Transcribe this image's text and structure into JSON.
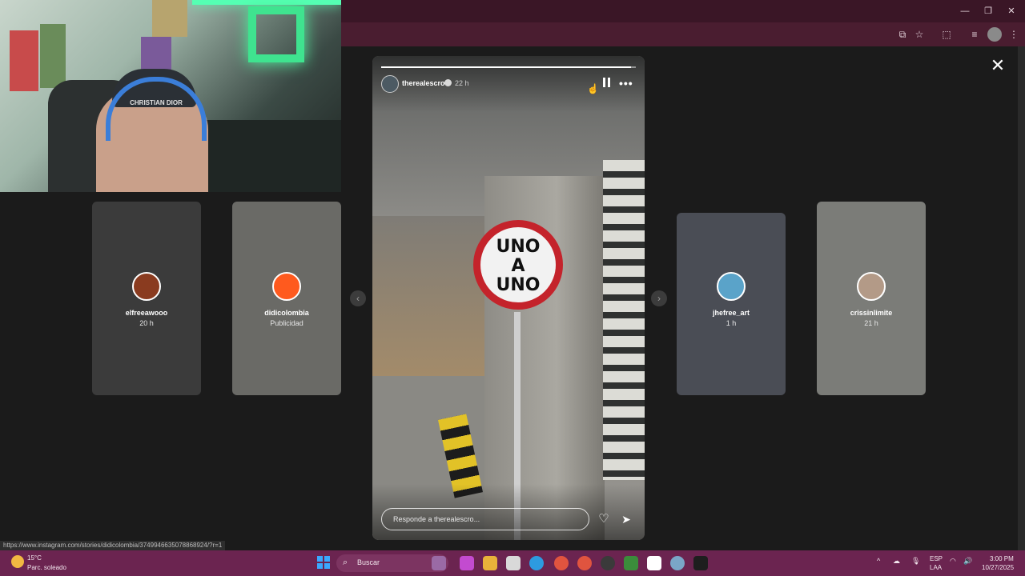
{
  "browser": {
    "window_controls": {
      "minimize": "—",
      "restore": "❐",
      "close": "✕"
    },
    "toolbar_icons": [
      "screencast-icon",
      "star-icon",
      "extensions-icon",
      "media-icon",
      "profile-icon",
      "menu-icon"
    ]
  },
  "webcam": {
    "cap_text": "CHRISTIAN DIOR"
  },
  "cards": [
    {
      "username": "elfreeawooo",
      "sub": "20 h",
      "bg": "#3b3b3b",
      "avatar": "#8a3b1f"
    },
    {
      "username": "didicolombia",
      "sub": "Publicidad",
      "bg": "#6a6a66",
      "avatar": "#ff5a1e"
    },
    {
      "username": "jhefree_art",
      "sub": "1 h",
      "bg": "#4a4d55",
      "avatar": "#5aa3c9"
    },
    {
      "username": "crissinlimite",
      "sub": "21 h",
      "bg": "#7b7c78",
      "avatar": "#b39a87"
    }
  ],
  "story": {
    "username": "therealescro",
    "time": "22 h",
    "progress": 0.98,
    "sign_lines": [
      "UNO",
      "A",
      "UNO"
    ],
    "reply_placeholder": "Responde a therealescro...",
    "more_label": "•••"
  },
  "nav": {
    "prev": "‹",
    "next": "›",
    "close": "✕"
  },
  "status_url": "https://www.instagram.com/stories/didicolombia/3749946635078868924/?r=1",
  "taskbar": {
    "weather_temp": "15°C",
    "weather_cond": "Parc. soleado",
    "search_label": "Buscar",
    "lang_line1": "ESP",
    "lang_line2": "LAA",
    "time": "3:00 PM",
    "date": "10/27/2025"
  }
}
